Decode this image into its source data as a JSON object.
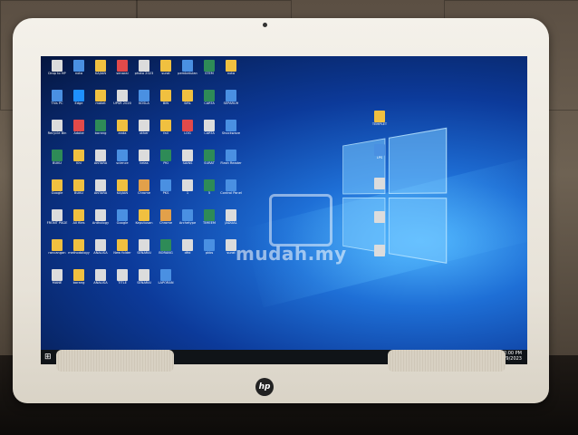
{
  "photo": {
    "watermark": "mudah.my"
  },
  "brand": {
    "logo_text": "hp"
  },
  "desktop": {
    "icons_left": [
      {
        "label": "Drop to HP",
        "color": "#dcdcdc"
      },
      {
        "label": "nota",
        "color": "#4a90e2"
      },
      {
        "label": "KAJIAN",
        "color": "#f0c040"
      },
      {
        "label": "senarai",
        "color": "#e24a4a"
      },
      {
        "label": "photo 2023",
        "color": "#dcdcdc"
      },
      {
        "label": "surat",
        "color": "#f0c040"
      },
      {
        "label": "pembetulan",
        "color": "#4a90e2"
      },
      {
        "label": "STEM",
        "color": "#2e8b57"
      },
      {
        "label": "nota",
        "color": "#f0c040"
      },
      {
        "label": "This PC",
        "color": "#4a90e2"
      },
      {
        "label": "Edge",
        "color": "#1e90ff"
      },
      {
        "label": "maket",
        "color": "#f0c040"
      },
      {
        "label": "UPSR 2020",
        "color": "#dcdcdc"
      },
      {
        "label": "KOSLA",
        "color": "#4a90e2"
      },
      {
        "label": "BIN",
        "color": "#f0c040"
      },
      {
        "label": "SIRL",
        "color": "#f0c040"
      },
      {
        "label": "CARTA",
        "color": "#2e8b57"
      },
      {
        "label": "SEPARUH",
        "color": "#4a90e2"
      },
      {
        "label": "Recycle Bin",
        "color": "#dcdcdc"
      },
      {
        "label": "Adobe",
        "color": "#e24a4a"
      },
      {
        "label": "borang",
        "color": "#2e8b57"
      },
      {
        "label": "anda",
        "color": "#f0c040"
      },
      {
        "label": "other",
        "color": "#dcdcdc"
      },
      {
        "label": "fail",
        "color": "#f0c040"
      },
      {
        "label": "LOG",
        "color": "#e24a4a"
      },
      {
        "label": "CARTA",
        "color": "#dcdcdc"
      },
      {
        "label": "Shockwave",
        "color": "#4a90e2"
      },
      {
        "label": "BUKU",
        "color": "#2e8b57"
      },
      {
        "label": "Khi",
        "color": "#f0c040"
      },
      {
        "label": "ANTARA",
        "color": "#dcdcdc"
      },
      {
        "label": "science",
        "color": "#4a90e2"
      },
      {
        "label": "kelas",
        "color": "#dcdcdc"
      },
      {
        "label": "PKI",
        "color": "#2e8b57"
      },
      {
        "label": "SAINS",
        "color": "#dcdcdc"
      },
      {
        "label": "SURAT",
        "color": "#2e8b57"
      },
      {
        "label": "Flash Reader",
        "color": "#4a90e2"
      },
      {
        "label": "Google",
        "color": "#f0c040"
      },
      {
        "label": "BUKU",
        "color": "#f0c040"
      },
      {
        "label": "ANTARA",
        "color": "#dcdcdc"
      },
      {
        "label": "KAJIAN",
        "color": "#f0c040"
      },
      {
        "label": "Chrome",
        "color": "#e2a04a"
      },
      {
        "label": "PKS",
        "color": "#4a90e2"
      },
      {
        "label": "1",
        "color": "#dcdcdc"
      },
      {
        "label": "5",
        "color": "#2e8b57"
      },
      {
        "label": "Control Panel",
        "color": "#4a90e2"
      },
      {
        "label": "FRONT PAGE",
        "color": "#dcdcdc"
      },
      {
        "label": "All files",
        "color": "#f0c040"
      },
      {
        "label": "Anthology",
        "color": "#dcdcdc"
      },
      {
        "label": "Google",
        "color": "#4a90e2"
      },
      {
        "label": "Keputusan",
        "color": "#f0c040"
      },
      {
        "label": "Chrome",
        "color": "#e2a04a"
      },
      {
        "label": "Archetype",
        "color": "#4a90e2"
      },
      {
        "label": "TIMEEM",
        "color": "#2e8b57"
      },
      {
        "label": "JADUAL",
        "color": "#dcdcdc"
      },
      {
        "label": "rancangan",
        "color": "#f0c040"
      },
      {
        "label": "methodology",
        "color": "#f0c040"
      },
      {
        "label": "ANALISA",
        "color": "#dcdcdc"
      },
      {
        "label": "New folder",
        "color": "#f0c040"
      },
      {
        "label": "SENARAI",
        "color": "#dcdcdc"
      },
      {
        "label": "BORANG",
        "color": "#2e8b57"
      },
      {
        "label": "dfid",
        "color": "#dcdcdc"
      },
      {
        "label": "pkbs",
        "color": "#4a90e2"
      },
      {
        "label": "surat",
        "color": "#dcdcdc"
      },
      {
        "label": "MANE",
        "color": "#dcdcdc"
      },
      {
        "label": "borang",
        "color": "#f0c040"
      },
      {
        "label": "ANALISA",
        "color": "#dcdcdc"
      },
      {
        "label": "TITLE",
        "color": "#dcdcdc"
      },
      {
        "label": "SENARAI",
        "color": "#dcdcdc"
      },
      {
        "label": "LAPORAN",
        "color": "#4a90e2"
      }
    ],
    "icons_right": [
      {
        "label": "TEMPLET",
        "color": "#f0c040"
      },
      {
        "label": "LPS",
        "color": "#4a90e2"
      },
      {
        "label": "",
        "color": "#dcdcdc"
      },
      {
        "label": "",
        "color": "#dcdcdc"
      },
      {
        "label": "",
        "color": "#dcdcdc"
      }
    ]
  },
  "taskbar": {
    "start_icon": "windows-logo-icon",
    "pinned": [
      {
        "icon": "search-icon",
        "color": "#c0c0c0"
      },
      {
        "icon": "edge-icon",
        "color": "#1e90ff"
      },
      {
        "icon": "folder-icon",
        "color": "#f0c040"
      },
      {
        "icon": "store-icon",
        "color": "#4a90e2"
      },
      {
        "icon": "chrome-icon",
        "color": "#e24a4a"
      },
      {
        "icon": "word-icon",
        "color": "#2b5797"
      },
      {
        "icon": "excel-icon",
        "color": "#2e8b57"
      },
      {
        "icon": "powerpoint-icon",
        "color": "#d24726"
      },
      {
        "icon": "app-icon",
        "color": "#c0c0c0"
      }
    ],
    "clock_time": "2:00 PM",
    "clock_date": "6/9/2023"
  }
}
